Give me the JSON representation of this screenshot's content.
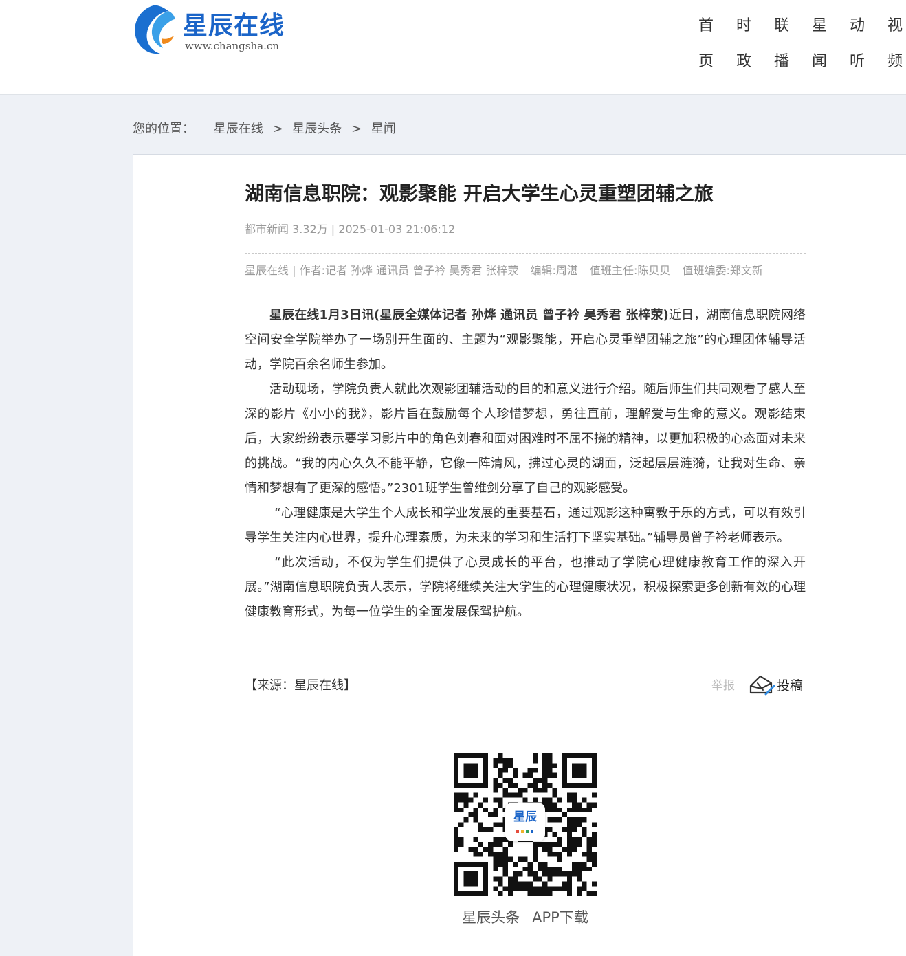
{
  "header": {
    "logo_name": "星辰在线",
    "logo_url": "www.changsha.cn",
    "nav": [
      {
        "line1": "首",
        "line2": "页"
      },
      {
        "line1": "时",
        "line2": "政"
      },
      {
        "line1": "联",
        "line2": "播"
      },
      {
        "line1": "星",
        "line2": "闻"
      },
      {
        "line1": "动",
        "line2": "听"
      },
      {
        "line1": "视",
        "line2": "频"
      }
    ]
  },
  "breadcrumb": {
    "label": "您的位置：",
    "items": [
      "星辰在线",
      "星辰头条",
      "星闻"
    ],
    "separator": ">"
  },
  "article": {
    "title": "湖南信息职院：观影聚能 开启大学生心灵重塑团辅之旅",
    "meta": "都市新闻 3.32万 | 2025-01-03 21:06:12",
    "credits": {
      "source_author": "星辰在线 | 作者:记者 孙烨 通讯员 曾子衿 吴秀君 张梓荥",
      "editor": "编辑:周湛",
      "duty_chief": "值班主任:陈贝贝",
      "duty_editor": "值班编委:郑文新"
    },
    "lead_bold": "星辰在线1月3日讯(星辰全媒体记者 孙烨 通讯员 曾子衿 吴秀君 张梓荥)",
    "lead_text": "近日，湖南信息职院网络空间安全学院举办了一场别开生面的、主题为“观影聚能，开启心灵重塑团辅之旅”的心理团体辅导活动，学院百余名师生参加。",
    "p2": "活动现场，学院负责人就此次观影团辅活动的目的和意义进行介绍。随后师生们共同观看了感人至深的影片《小小的我》，影片旨在鼓励每个人珍惜梦想，勇往直前，理解爱与生命的意义。观影结束后，大家纷纷表示要学习影片中的角色刘春和面对困难时不屈不挠的精神，以更加积极的心态面对未来的挑战。“我的内心久久不能平静，它像一阵清风，拂过心灵的湖面，泛起层层涟漪，让我对生命、亲情和梦想有了更深的感悟。”2301班学生曾维剑分享了自己的观影感受。",
    "p3": "“心理健康是大学生个人成长和学业发展的重要基石，通过观影这种寓教于乐的方式，可以有效引导学生关注内心世界，提升心理素质，为未来的学习和生活打下坚实基础。”辅导员曾子衿老师表示。",
    "p4": "“此次活动，不仅为学生们提供了心灵成长的平台，也推动了学院心理健康教育工作的深入开展。”湖南信息职院负责人表示，学院将继续关注大学生的心理健康状况，积极探索更多创新有效的心理健康教育形式，为每一位学生的全面发展保驾护航。",
    "source": "【来源：星辰在线】",
    "report_label": "举报",
    "submit_label": "投稿"
  },
  "app_promo": {
    "qr_badge": "星辰",
    "caption_left": "星辰头条",
    "caption_right": "APP下载"
  },
  "colors": {
    "brand_blue": "#1a64c8",
    "accent_orange": "#f08a1c",
    "page_bg": "#eef1f6"
  }
}
